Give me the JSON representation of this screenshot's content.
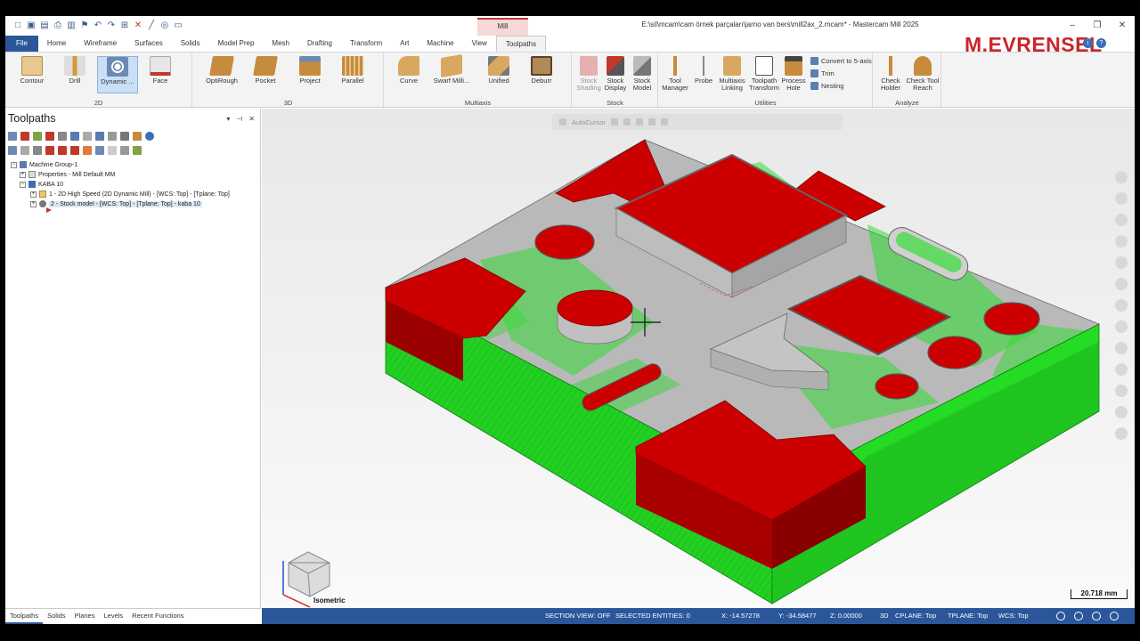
{
  "window": {
    "title": "E:\\sil\\mcam\\cam örnek parçaları\\jarno van bers\\mill2ax_2.mcam* - Mastercam Mill 2025",
    "context_tab": "Mill"
  },
  "logo_text": "M.EVRENSEL",
  "tabs": [
    "File",
    "Home",
    "Wireframe",
    "Surfaces",
    "Solids",
    "Model Prep",
    "Mesh",
    "Drafting",
    "Transform",
    "Art",
    "Machine",
    "View",
    "Toolpaths"
  ],
  "ribbon": {
    "groups": [
      {
        "name": "2D",
        "buttons": [
          "Contour",
          "Drill",
          "Dynamic ...",
          "Face"
        ]
      },
      {
        "name": "3D",
        "buttons": [
          "OptiRough",
          "Pocket",
          "Project",
          "Parallel"
        ]
      },
      {
        "name": "Multiaxis",
        "buttons": [
          "Curve",
          "Swarf Milli...",
          "Unified",
          "Deburr"
        ]
      },
      {
        "name": "Stock",
        "buttons": [
          "Stock Shading",
          "Stock Display",
          "Stock Model"
        ]
      },
      {
        "name": "Utilities",
        "buttons": [
          "Tool Manager",
          "Probe",
          "Multiaxis Linking",
          "Toolpath Transform",
          "Process Hole"
        ],
        "small": [
          "Convert to 5-axis",
          "Trim",
          "Nesting"
        ]
      },
      {
        "name": "Analyze",
        "buttons": [
          "Check Holder",
          "Check Tool Reach"
        ]
      }
    ]
  },
  "panel": {
    "title": "Toolpaths",
    "tree": [
      {
        "label": "Machine Group-1",
        "level": 0
      },
      {
        "label": "Properties - Mill Default MM",
        "level": 1
      },
      {
        "label": "KABA 10",
        "level": 1
      },
      {
        "label": "1 - 2D High Speed (2D Dynamic Mill) - [WCS: Top] - [Tplane: Top]",
        "level": 2
      },
      {
        "label": "2 - Stock model - [WCS: Top] - [Tplane: Top] - kaba 10",
        "level": 2
      }
    ],
    "bottom_tabs": [
      "Toolpaths",
      "Solids",
      "Planes",
      "Levels",
      "Recent Functions"
    ]
  },
  "viewport": {
    "autocursor": "AutoCursor",
    "scale": "20.718 mm",
    "view": "Isometric",
    "colors": {
      "red": "#cc0000",
      "green": "#1ee01e",
      "grey": "#b9b9b9"
    }
  },
  "status": {
    "section_view": "SECTION VIEW: OFF",
    "selected": "SELECTED ENTITIES: 0",
    "x": "X:   -14.57278",
    "y": "Y:   -34.58477",
    "z": "Z:   0.00000",
    "mode": "3D",
    "cplane": "CPLANE: Top",
    "tplane": "TPLANE: Top",
    "wcs": "WCS: Top"
  }
}
